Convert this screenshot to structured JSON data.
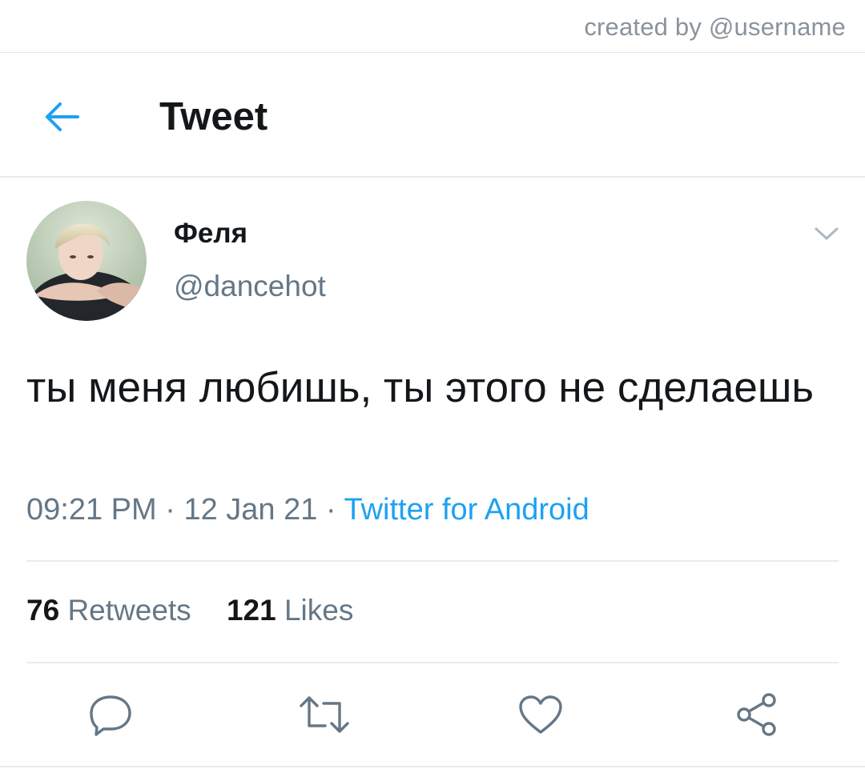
{
  "credit": "created by @username",
  "header": {
    "title": "Tweet"
  },
  "tweet": {
    "author": {
      "name": "Феля",
      "handle": "@dancehot"
    },
    "text": "ты меня любишь, ты этого не сделаешь",
    "time": "09:21 PM",
    "date": "12 Jan 21",
    "source": "Twitter for Android"
  },
  "stats": {
    "retweets_count": "76",
    "retweets_label": "Retweets",
    "likes_count": "121",
    "likes_label": "Likes"
  },
  "icons": {
    "back": "arrow-left-icon",
    "caret": "chevron-down-icon",
    "reply": "reply-icon",
    "retweet": "retweet-icon",
    "like": "heart-icon",
    "share": "share-icon"
  },
  "colors": {
    "accent": "#1da1f2",
    "text": "#14171a",
    "secondary": "#657786",
    "icon": "#657786",
    "divider": "#e6ecf0"
  }
}
